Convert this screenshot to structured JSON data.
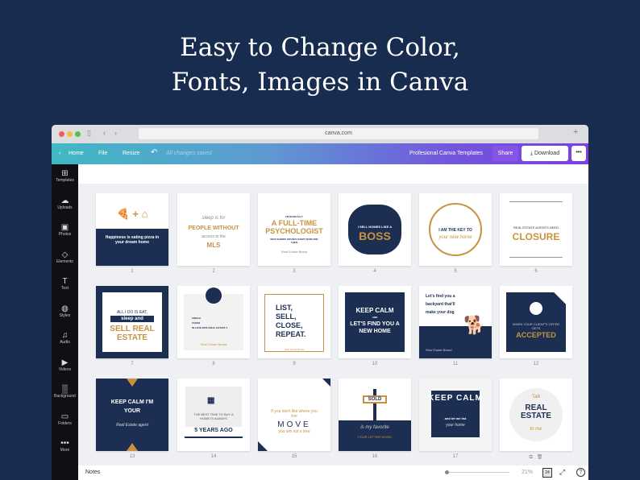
{
  "headline": [
    "Easy to Change Color,",
    "Fonts, Images in Canva"
  ],
  "browser": {
    "url": "canva.com",
    "back": "‹",
    "forward": "›",
    "new_tab": "+"
  },
  "toolbar": {
    "home": "Home",
    "file": "File",
    "resize": "Resize",
    "undo": "↶",
    "status": "All changes saved",
    "project": "Profesional Canva Templates",
    "share": "Share",
    "download": "Download",
    "more": "•••"
  },
  "sidebar": [
    {
      "icon": "⊞",
      "label": "Templates"
    },
    {
      "icon": "☁",
      "label": "Uploads"
    },
    {
      "icon": "▣",
      "label": "Photos"
    },
    {
      "icon": "◇",
      "label": "Elements"
    },
    {
      "icon": "T",
      "label": "Text"
    },
    {
      "icon": "◍",
      "label": "Styles"
    },
    {
      "icon": "♫",
      "label": "Audio"
    },
    {
      "icon": "▶",
      "label": "Videos"
    },
    {
      "icon": "▒",
      "label": "Background"
    },
    {
      "icon": "▭",
      "label": "Folders"
    },
    {
      "icon": "•••",
      "label": "More"
    }
  ],
  "cards": [
    {
      "num": "1",
      "lines": [
        "🍕 + ⌂",
        "Happiness is eating pizza in your dream home"
      ]
    },
    {
      "num": "2",
      "lines": [
        "sleep is for",
        "PEOPLE WITHOUT",
        "access to the",
        "MLS"
      ]
    },
    {
      "num": "3",
      "lines": [
        "I'M BASICALLY",
        "A FULL-TIME PSYCHOLOGIST",
        "WHO SHOWS HOUSES EVERY NOW AND THEN",
        "Real Estate Brand"
      ]
    },
    {
      "num": "4",
      "lines": [
        "I SELL HOMES LIKE A",
        "BOSS"
      ]
    },
    {
      "num": "5",
      "lines": [
        "I AM THE KEY TO",
        "your new home"
      ]
    },
    {
      "num": "6",
      "lines": [
        "REAL ESTATE AGENTS NEED",
        "CLOSURE"
      ]
    },
    {
      "num": "7",
      "lines": [
        "ALL I DO IS EAT,",
        "sleep and",
        "SELL REAL ESTATE"
      ]
    },
    {
      "num": "8",
      "lines": [
        "SINGLE",
        "TAKEN",
        "IN LOVE WITH REAL ESTATE ♥",
        "Real Estate Brand"
      ]
    },
    {
      "num": "9",
      "lines": [
        "LIST,",
        "SELL,",
        "CLOSE,",
        "REPEAT.",
        "Real Estate Brand"
      ]
    },
    {
      "num": "10",
      "lines": [
        "KEEP CALM",
        "AND",
        "LET'S FIND YOU A NEW HOME"
      ]
    },
    {
      "num": "11",
      "lines": [
        "Let's find you a backyard that'll make your dog",
        "Real Estate Brand"
      ]
    },
    {
      "num": "12",
      "lines": [
        "WHEN YOUR CLIENT'S OFFER GETS",
        "ACCEPTED"
      ]
    },
    {
      "num": "13",
      "lines": [
        "KEEP CALM I'M YOUR",
        "Real Estate agent"
      ]
    },
    {
      "num": "14",
      "lines": [
        "THE BEST TIME TO BUY A HOME IS ALWAYS",
        "5 YEARS AGO"
      ]
    },
    {
      "num": "15",
      "lines": [
        "If you don't like where you live",
        "MOVE",
        "you are not a tree"
      ]
    },
    {
      "num": "16",
      "lines": [
        "SOLD",
        "is my favorite",
        "FOUR LETTER WORD"
      ]
    },
    {
      "num": "17",
      "lines": [
        "KEEP CALM",
        "and let me list",
        "your home"
      ]
    },
    {
      "num": "18",
      "lines": [
        "Talk",
        "REAL ESTATE",
        "to me"
      ]
    }
  ],
  "bottom": {
    "notes": "Notes",
    "zoom": "21%",
    "pages": "24",
    "help": "?"
  },
  "colors": {
    "navy": "#1c2e52",
    "gold": "#c89240",
    "background": "#172c4f"
  }
}
